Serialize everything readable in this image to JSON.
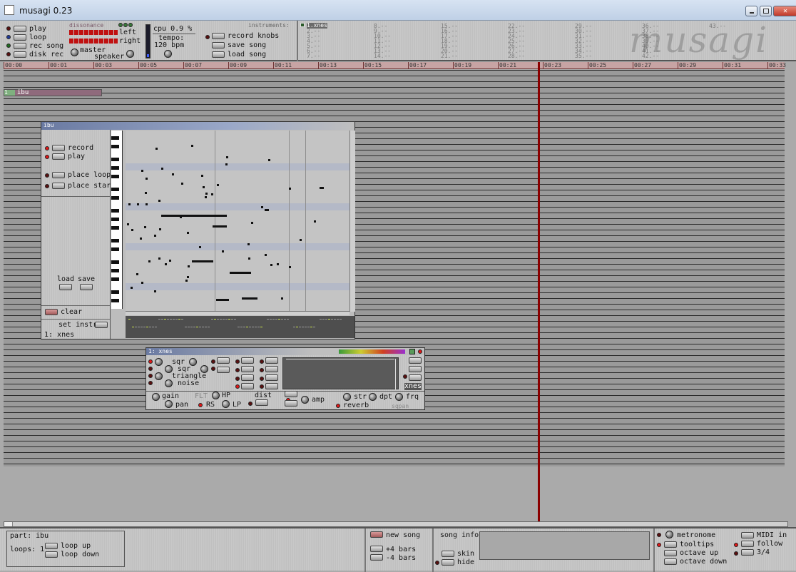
{
  "window": {
    "title": "musagi 0.23"
  },
  "transport": {
    "play": "play",
    "loop": "loop",
    "rec_song": "rec song",
    "disk_rec": "disk rec"
  },
  "mixer": {
    "dissonance": "dissonance",
    "left": "left",
    "right": "right",
    "master": "master",
    "speaker": "speaker"
  },
  "cpu": {
    "label": "cpu 0.9 %",
    "tempo_label": "tempo:",
    "tempo_value": "120 bpm"
  },
  "song_buttons": {
    "record_knobs": "record knobs",
    "save_song": "save song",
    "load_song": "load song"
  },
  "instruments": {
    "heading": "instruments:",
    "selected": "1.xnes",
    "slots": [
      "2.--",
      "3.--",
      "4.--",
      "5.--",
      "6.--",
      "7.--",
      "8.--",
      "9.--",
      "10.--",
      "11.--",
      "12.--",
      "13.--",
      "14.--",
      "15.--",
      "16.--",
      "17.--",
      "18.--",
      "19.--",
      "20.--",
      "21.--",
      "22.--",
      "23.--",
      "24.--",
      "25.--",
      "26.--",
      "27.--",
      "28.--",
      "29.--",
      "30.--",
      "31.--",
      "32.--",
      "33.--",
      "34.--",
      "35.--",
      "36.--",
      "37.--",
      "38.--",
      "39.--",
      "40.--",
      "41.--",
      "42.--",
      "43.--"
    ]
  },
  "logo": "musagi",
  "timeline": [
    "00:00",
    "00:01",
    "00:03",
    "00:05",
    "00:07",
    "00:09",
    "00:11",
    "00:13",
    "00:15",
    "00:17",
    "00:19",
    "00:21",
    "00:23",
    "00:25",
    "00:27",
    "00:29",
    "00:31",
    "00:33"
  ],
  "part": {
    "index": "1",
    "name": "ibu"
  },
  "piano_roll": {
    "title": "ibu",
    "record": "record",
    "play": "play",
    "place_loop": "place loop",
    "place_start": "place start",
    "load": "load",
    "save": "save",
    "clear": "clear",
    "set_instr": "set instr.",
    "instrument": "1: xnes"
  },
  "synth": {
    "title": "1: xnes",
    "sqr1": "sqr",
    "sqr2": "sqr",
    "triangle": "triangle",
    "noise": "noise",
    "gain": "gain",
    "pan": "pan",
    "flt": "FLT",
    "hp": "HP",
    "rs": "RS",
    "lp": "LP",
    "dist": "dist",
    "amp": "amp",
    "str": "str",
    "dpt": "dpt",
    "rvb_freq": "frq",
    "reverb": "reverb",
    "name_tag": "xnes",
    "brand": "sqpan"
  },
  "bottom": {
    "part_label": "part: ibu",
    "loops_label": "loops: 1",
    "loop_up": "loop up",
    "loop_down": "loop down",
    "new_song": "new song",
    "plus4": "+4 bars",
    "minus4": "-4 bars",
    "song_info": "song info:",
    "skin": "skin",
    "hide": "hide",
    "metronome": "metronome",
    "tooltips": "tooltips",
    "octave_up": "octave up",
    "octave_down": "octave down",
    "midi_in": "MIDI in",
    "follow": "follow",
    "three_four": "3/4"
  },
  "colors": {
    "playhead": "#8a0000",
    "title_bar": "#c8d8ee",
    "part_bar": "#8f6a7c",
    "led_on": "#e01818"
  }
}
